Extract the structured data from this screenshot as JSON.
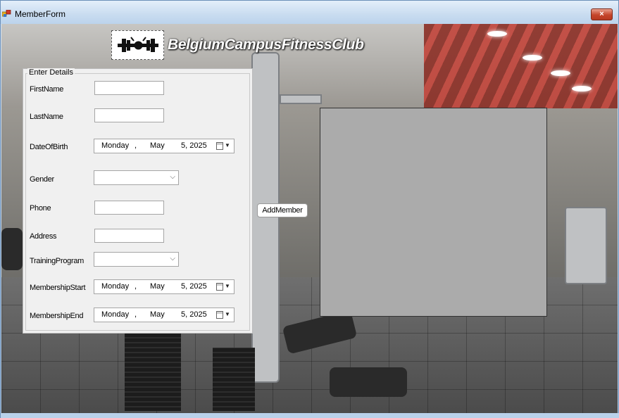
{
  "window": {
    "title": "MemberForm",
    "close_glyph": "×"
  },
  "header": {
    "brand": "BelgiumCampusFitnessClub",
    "logo_icon": "dumbbell-logo"
  },
  "form": {
    "group_title": "Enter Details",
    "first_name_label": "FirstName",
    "last_name_label": "LastName",
    "dob_label": "DateOfBirth",
    "gender_label": "Gender",
    "phone_label": "Phone",
    "address_label": "Address",
    "training_label": "TrainingProgram",
    "start_label": "MembershipStart",
    "end_label": "MembershipEnd",
    "first_name_value": "",
    "last_name_value": "",
    "phone_value": "",
    "address_value": "",
    "gender_value": "",
    "training_value": "",
    "dob": {
      "day": "Monday",
      "sep": ",",
      "month": "May",
      "date": "5, 2025"
    },
    "start": {
      "day": "Monday",
      "sep": ",",
      "month": "May",
      "date": "5, 2025"
    },
    "end": {
      "day": "Monday",
      "sep": ",",
      "month": "May",
      "date": "5, 2025"
    }
  },
  "actions": {
    "add_member": "AddMember"
  },
  "colors": {
    "panel_gray": "#ababab",
    "group_bg": "#f0f0f0",
    "close_red": "#c5452b"
  }
}
